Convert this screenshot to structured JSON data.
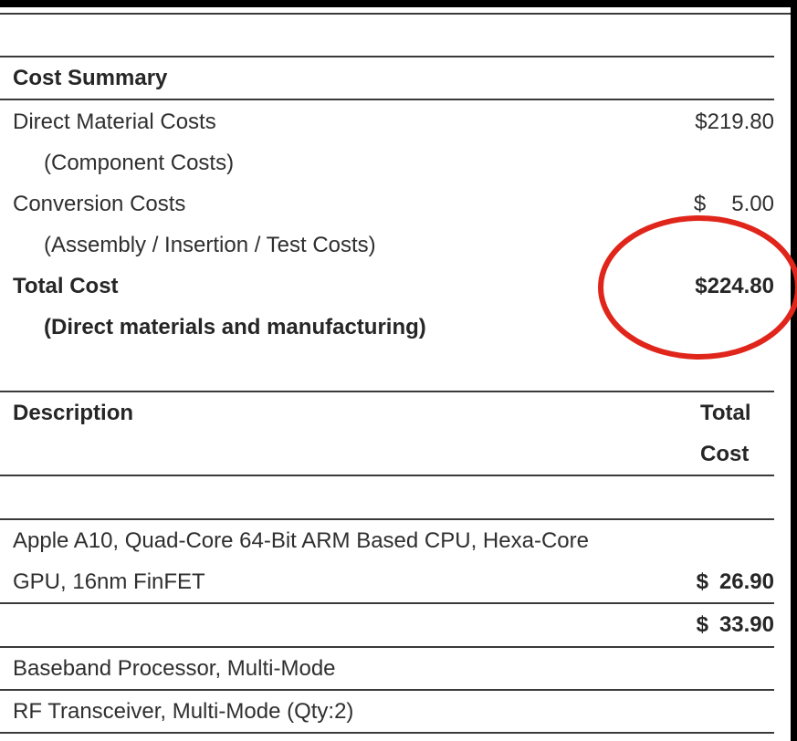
{
  "cost_summary": {
    "heading": "Cost Summary",
    "direct_material": {
      "label": "Direct Material Costs",
      "sublabel": "(Component Costs)",
      "currency": "$",
      "amount": "219.80"
    },
    "conversion": {
      "label": "Conversion Costs",
      "sublabel": "(Assembly / Insertion / Test Costs)",
      "currency": "$",
      "amount": "5.00"
    },
    "total": {
      "label": "Total Cost",
      "sublabel": "(Direct materials and manufacturing)",
      "currency": "$",
      "amount": "224.80"
    }
  },
  "table": {
    "col_description": "Description",
    "col_total_line1": "Total",
    "col_total_line2": "Cost",
    "rows": [
      {
        "desc_line1": "Apple A10, Quad-Core 64-Bit ARM Based CPU, Hexa-Core",
        "desc_line2": "GPU, 16nm FinFET",
        "currency": "$",
        "amount": "26.90"
      },
      {
        "desc_line1": "",
        "currency": "$",
        "amount": "33.90"
      },
      {
        "desc_line1": "Baseband Processor, Multi-Mode"
      },
      {
        "desc_line1": "RF Transceiver, Multi-Mode (Qty:2)"
      }
    ]
  },
  "annotation": {
    "color": "#e0251b"
  }
}
